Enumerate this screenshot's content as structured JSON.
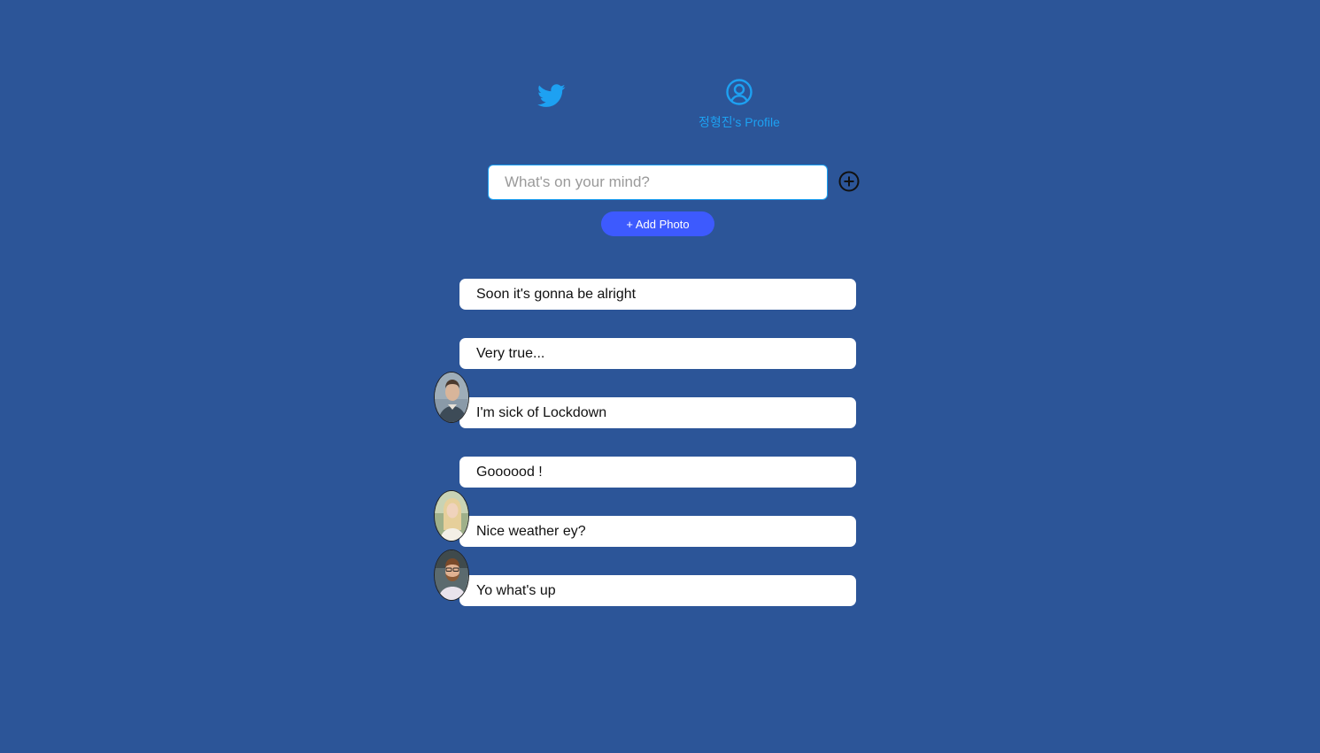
{
  "nav": {
    "home_icon": "twitter-bird-icon",
    "profile_icon": "user-circle-icon",
    "profile_label": "정형진's Profile",
    "accent_color": "#1da1f2"
  },
  "composer": {
    "placeholder": "What's on your mind?",
    "value": "",
    "submit_icon": "plus-circle-icon",
    "add_photo_label": "+ Add Photo",
    "add_photo_color": "#3d5afe"
  },
  "tweets": [
    {
      "text": "Soon it's gonna be alright",
      "has_photo": false
    },
    {
      "text": "Very true...",
      "has_photo": false
    },
    {
      "text": "I'm sick of Lockdown",
      "has_photo": true,
      "photo": "man-portrait"
    },
    {
      "text": "Goooood !",
      "has_photo": false
    },
    {
      "text": "Nice weather ey?",
      "has_photo": true,
      "photo": "woman-portrait"
    },
    {
      "text": "Yo what's up",
      "has_photo": true,
      "photo": "bearded-man-portrait"
    }
  ],
  "colors": {
    "background": "#2c5598",
    "tweet_bg": "#ffffff"
  }
}
